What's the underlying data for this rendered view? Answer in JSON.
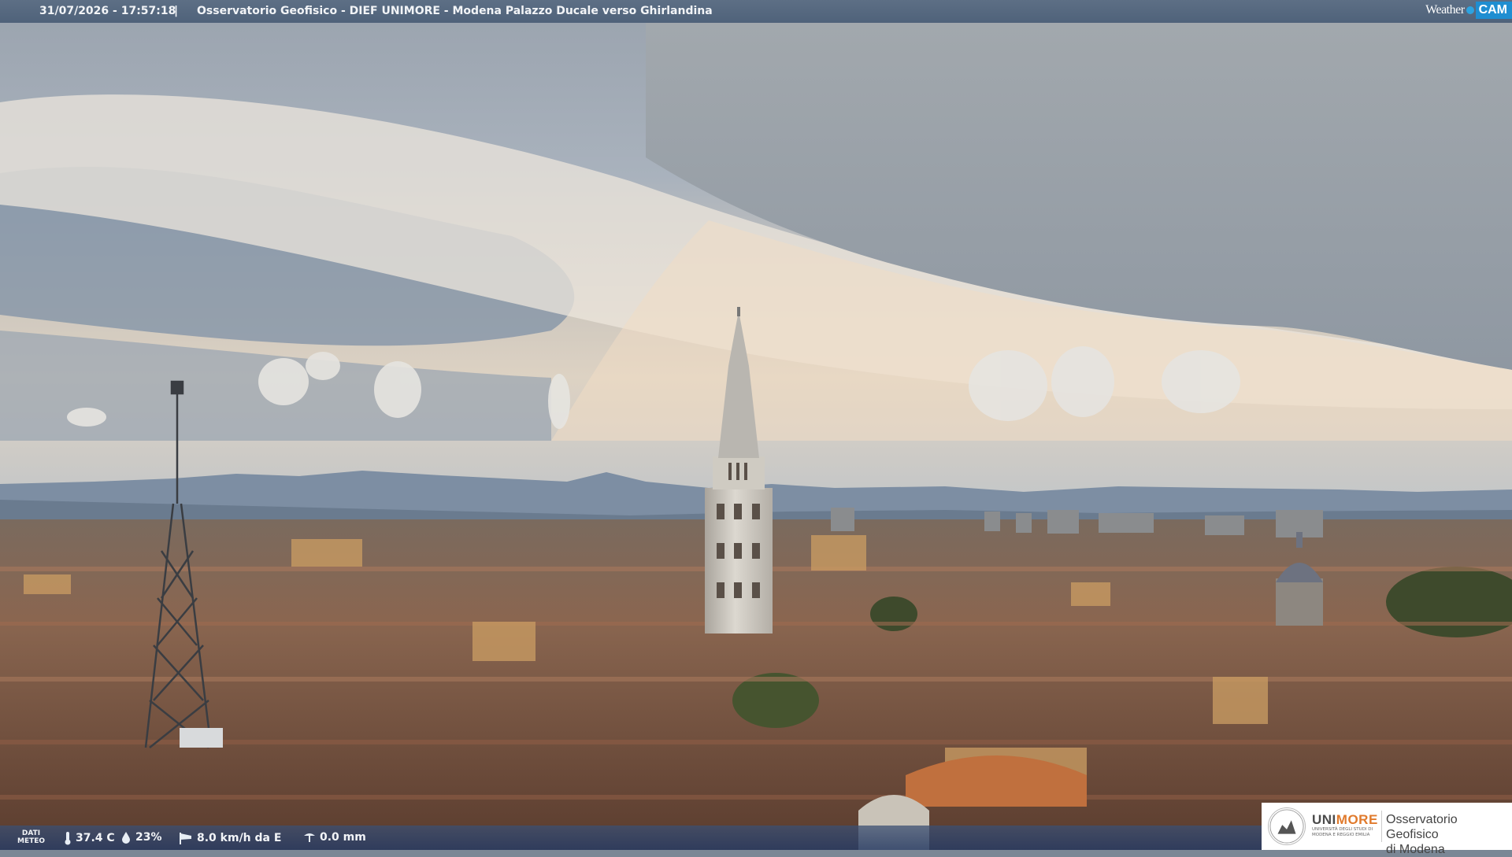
{
  "header": {
    "datetime": "31/07/2026 - 17:57:18",
    "separator": "|",
    "title": "Osservatorio Geofisico - DIEF UNIMORE - Modena Palazzo Ducale verso Ghirlandina",
    "brand_word": "Weather",
    "brand_cam": "CAM"
  },
  "weather_data": {
    "label_line1": "DATI",
    "label_line2": "METEO",
    "temperature": "37.4 C",
    "humidity": "23%",
    "wind": "8.0 km/h da E",
    "rain": "0.0 mm",
    "icons": [
      "thermometer-icon",
      "humidity-drop-icon",
      "wind-sock-icon",
      "rain-gauge-icon"
    ]
  },
  "logo": {
    "uni_part1": "UNI",
    "uni_part2": "MORE",
    "uni_sub": "UNIVERSITÀ DEGLI STUDI DI MODENA E REGGIO EMILIA",
    "obs_line1": "Osservatorio Geofisico",
    "obs_line2": "di Modena"
  },
  "colors": {
    "sky_top": "#8f9aa8",
    "sky_glow": "#f1dcc4",
    "roof": "#8a5a42",
    "tower": "#d9d6cf",
    "brand_blue": "#1f8ed1",
    "unimore_orange": "#e07a2c"
  }
}
